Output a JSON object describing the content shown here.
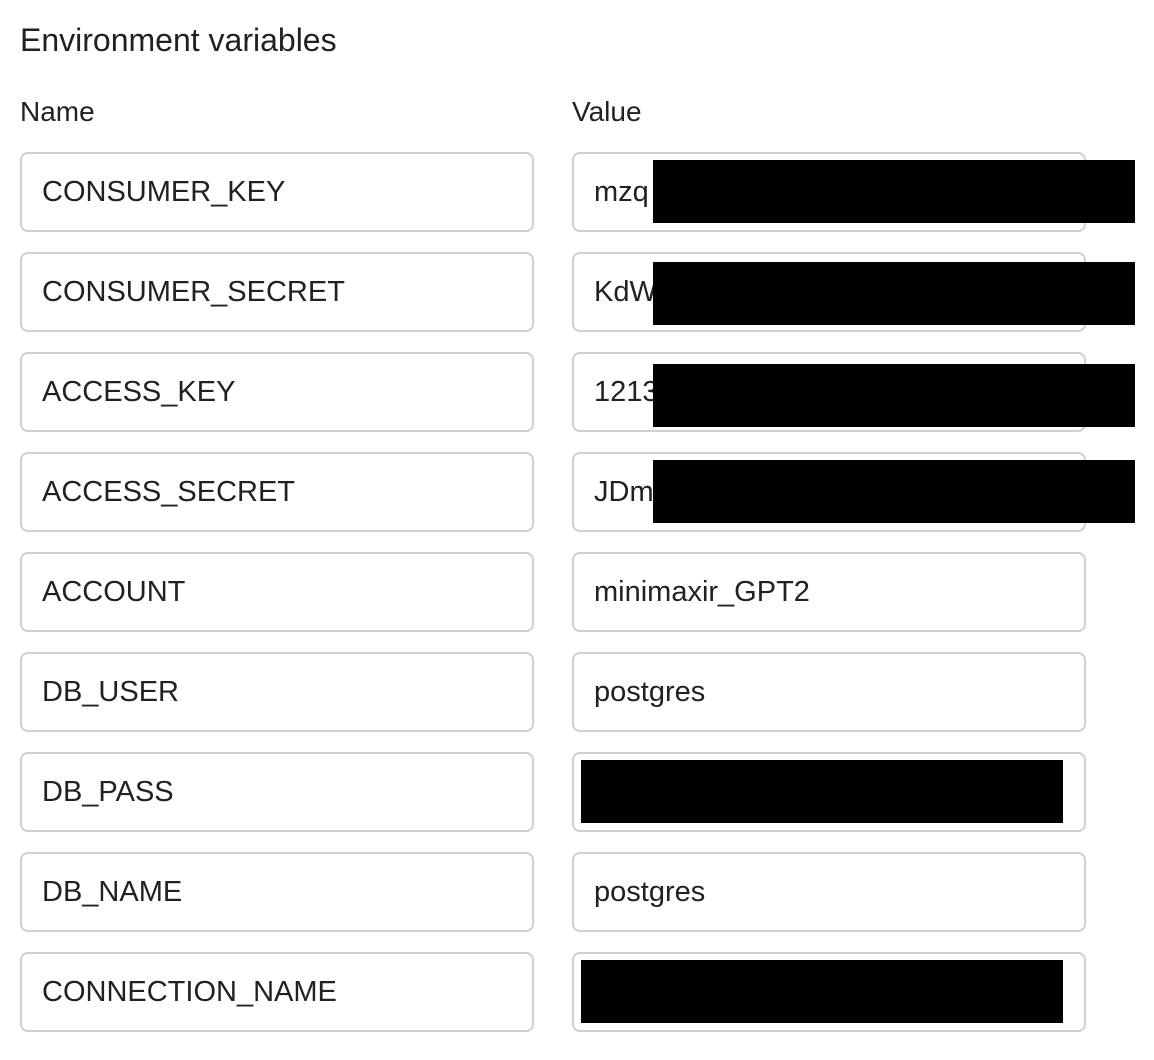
{
  "section": {
    "title": "Environment variables"
  },
  "columns": {
    "name": "Name",
    "value": "Value"
  },
  "variables": [
    {
      "name": "CONSUMER_KEY",
      "value": "mzq",
      "redacted": true
    },
    {
      "name": "CONSUMER_SECRET",
      "value": "KdW",
      "redacted": true
    },
    {
      "name": "ACCESS_KEY",
      "value": "1213",
      "redacted": true
    },
    {
      "name": "ACCESS_SECRET",
      "value": "JDm",
      "redacted": true
    },
    {
      "name": "ACCOUNT",
      "value": "minimaxir_GPT2",
      "redacted": false
    },
    {
      "name": "DB_USER",
      "value": "postgres",
      "redacted": false
    },
    {
      "name": "DB_PASS",
      "value": "",
      "redacted": true
    },
    {
      "name": "DB_NAME",
      "value": "postgres",
      "redacted": false
    },
    {
      "name": "CONNECTION_NAME",
      "value": "",
      "redacted": true
    }
  ],
  "colors": {
    "border": "#d0d0d0",
    "redaction": "#000000",
    "text": "#202124"
  }
}
